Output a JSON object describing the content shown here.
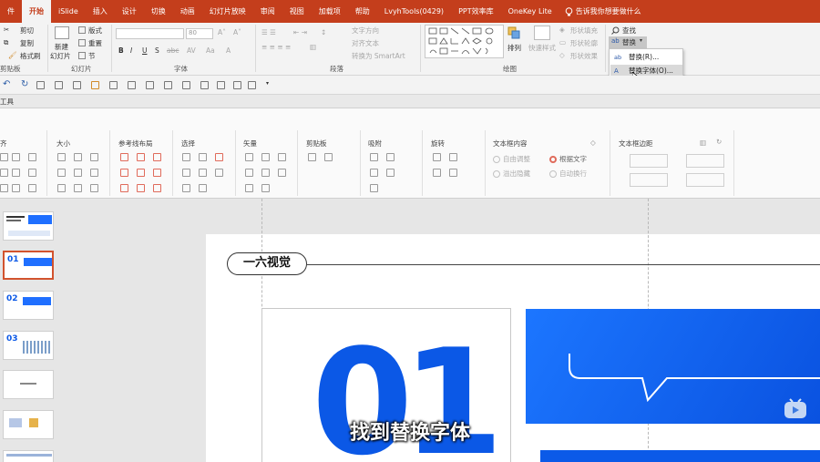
{
  "tabs": [
    {
      "label": "件",
      "active": false
    },
    {
      "label": "开始",
      "active": true
    },
    {
      "label": "iSlide",
      "active": false
    },
    {
      "label": "插入",
      "active": false
    },
    {
      "label": "设计",
      "active": false
    },
    {
      "label": "切换",
      "active": false
    },
    {
      "label": "动画",
      "active": false
    },
    {
      "label": "幻灯片放映",
      "active": false
    },
    {
      "label": "审阅",
      "active": false
    },
    {
      "label": "视图",
      "active": false
    },
    {
      "label": "加载项",
      "active": false
    },
    {
      "label": "帮助",
      "active": false
    },
    {
      "label": "LvyhTools(0429)",
      "active": false
    },
    {
      "label": "PPT效率库",
      "active": false
    },
    {
      "label": "OneKey Lite",
      "active": false
    }
  ],
  "tell_me": "告诉我你想要做什么",
  "ribbon": {
    "clipboard": {
      "cut": "剪切",
      "copy": "复制",
      "format_painter": "格式刷",
      "group": "剪贴板"
    },
    "slides": {
      "new_slide": "新建",
      "new_slide2": "幻灯片",
      "layout": "版式",
      "reset": "重置",
      "section": "节",
      "group": "幻灯片"
    },
    "font": {
      "name_value": "",
      "size_value": "80",
      "group": "字体"
    },
    "paragraph": {
      "text_direction": "文字方向",
      "align_text": "对齐文本",
      "smartart": "转换为 SmartArt",
      "group": "段落"
    },
    "drawing": {
      "arrange": "排列",
      "quick_styles": "快速样式",
      "fill": "形状填充",
      "outline": "形状轮廓",
      "effects": "形状效果",
      "group": "绘图"
    },
    "editing": {
      "find": "查找",
      "replace": "替换"
    }
  },
  "dropdown": {
    "items": [
      {
        "label": "替换(R)..."
      },
      {
        "label": "替换字体(O)..."
      }
    ]
  },
  "tool_header": "工具",
  "tool_pane": {
    "groups": [
      "齐",
      "大小",
      "参考线布局",
      "选择",
      "矢量",
      "剪贴板",
      "吸附",
      "旋转",
      "文本框内容",
      "文本框边距"
    ],
    "textbox_options": [
      "自由调整",
      "根据文字",
      "溢出隐藏",
      "自动换行"
    ]
  },
  "thumbnails": [
    {
      "num": ""
    },
    {
      "num": "01"
    },
    {
      "num": "02"
    },
    {
      "num": "03"
    },
    {
      "num": ""
    },
    {
      "num": ""
    },
    {
      "num": ""
    }
  ],
  "slide": {
    "badge": "一六视觉",
    "big_number": "01"
  },
  "caption": "找到替换字体",
  "colors": {
    "accent": "#c43e1c",
    "blue": "#0b58e6"
  }
}
